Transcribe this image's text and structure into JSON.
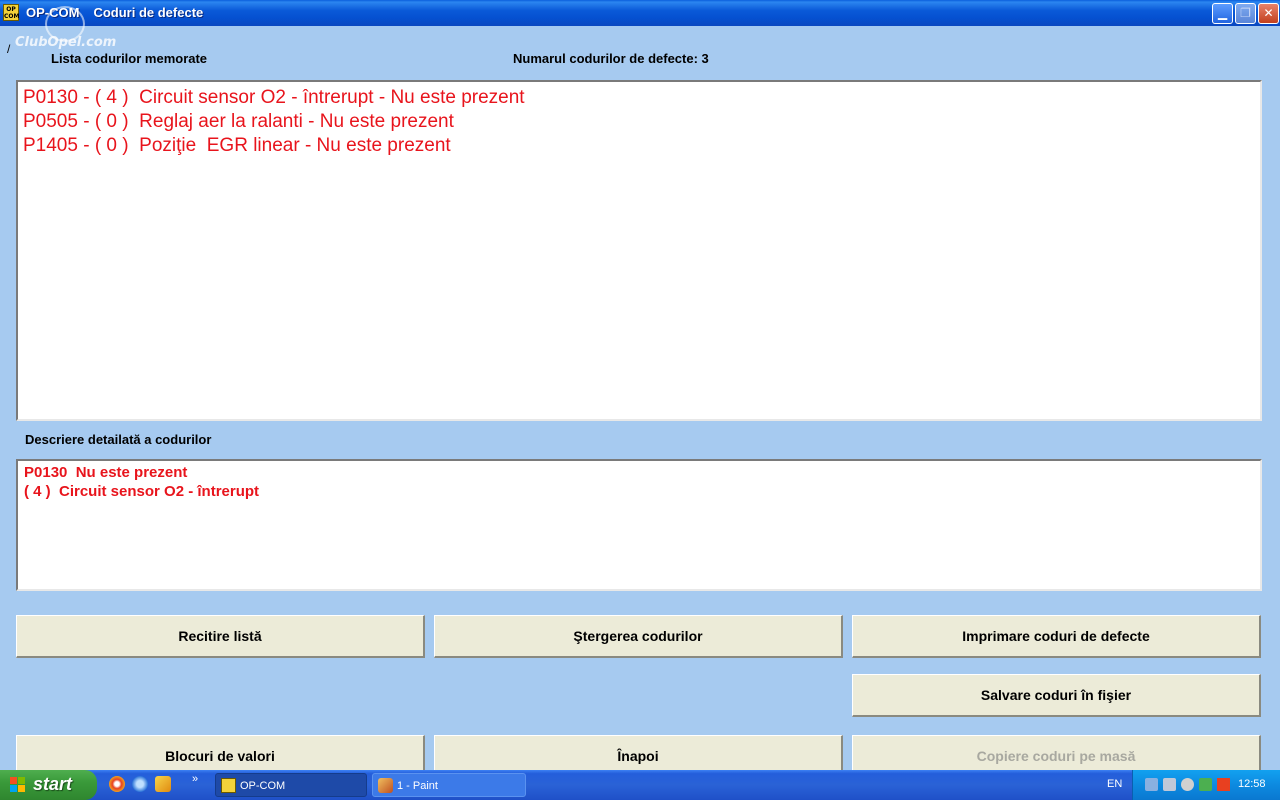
{
  "window": {
    "app_name": "OP-COM",
    "title": "Coduri de defecte",
    "icon_text": "OP COM",
    "watermark": "ClubOpel.com"
  },
  "header": {
    "slash": "/",
    "stored_codes_label": "Lista codurilor memorate",
    "codes_count_label": "Numarul codurilor de defecte: 3"
  },
  "codes": [
    "P0130 - ( 4 )  Circuit sensor O2 - întrerupt - Nu este prezent",
    "P0505 - ( 0 )  Reglaj aer la ralanti - Nu este prezent",
    "P1405 - ( 0 )  Poziţie  EGR linear - Nu este prezent"
  ],
  "detail": {
    "label": "Descriere detailată a codurilor",
    "lines": [
      "P0130  Nu este prezent",
      "( 4 )  Circuit sensor O2 - întrerupt"
    ]
  },
  "buttons": {
    "reread": "Recitire listă",
    "clear": "Ştergerea codurilor",
    "print": "Imprimare coduri de defecte",
    "save": "Salvare coduri în fişier",
    "blocks": "Blocuri de valori",
    "back": "Înapoi",
    "copy": "Copiere coduri pe masă"
  },
  "taskbar": {
    "start": "start",
    "task_opcom": "OP-COM",
    "task_paint": "1 - Paint",
    "language": "EN",
    "clock": "12:58"
  },
  "colors": {
    "window_bg": "#a6caf0",
    "code_text": "#e8141c",
    "button_face": "#ecebd8"
  }
}
